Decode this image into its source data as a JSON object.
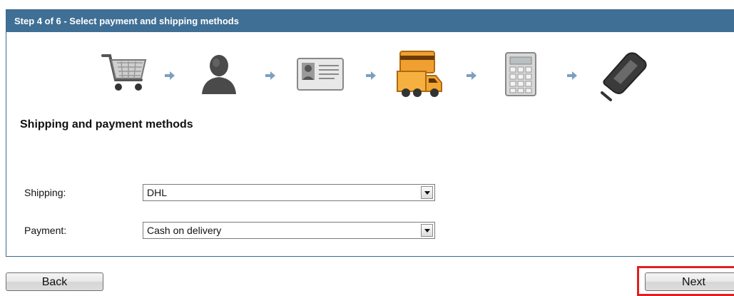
{
  "panel": {
    "title": "Step 4 of 6 - Select payment and shipping methods"
  },
  "steps": {
    "icons": [
      "cart-icon",
      "customer-icon",
      "address-card-icon",
      "shipping-truck-icon",
      "calculator-icon",
      "card-reader-icon"
    ],
    "current_index": 3
  },
  "section": {
    "title": "Shipping and payment methods"
  },
  "form": {
    "shipping_label": "Shipping:",
    "shipping_value": "DHL",
    "payment_label": "Payment:",
    "payment_value": "Cash on delivery"
  },
  "buttons": {
    "back_label": "Back",
    "next_label": "Next"
  },
  "colors": {
    "header_bg": "#3f6f95",
    "highlight_border": "#e02020"
  }
}
